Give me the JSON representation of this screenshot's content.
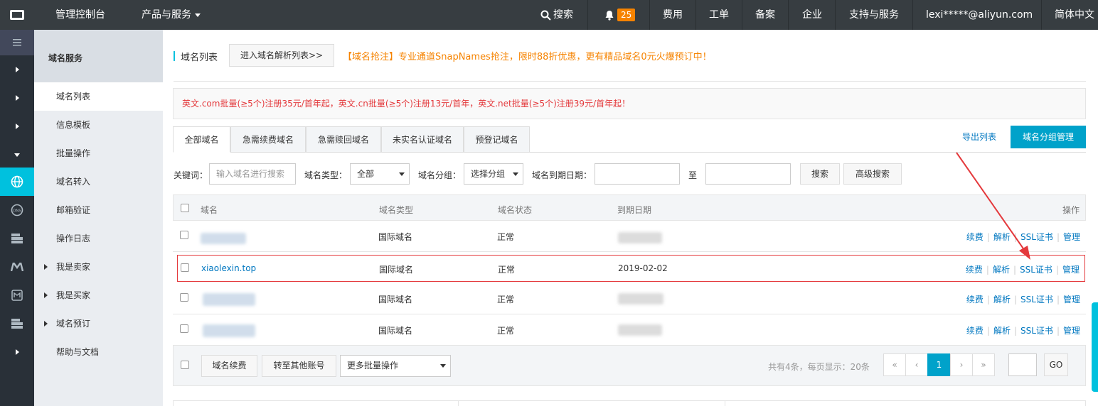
{
  "topbar": {
    "console": "管理控制台",
    "products": "产品与服务",
    "search": "搜索",
    "bell_count": "25",
    "billing": "费用",
    "ticket": "工单",
    "icp": "备案",
    "enterprise": "企业",
    "support": "支持与服务",
    "user": "lexi*****@aliyun.com",
    "language": "简体中文"
  },
  "sidebar": {
    "title": "域名服务",
    "items": [
      {
        "label": "域名列表"
      },
      {
        "label": "信息模板"
      },
      {
        "label": "批量操作"
      },
      {
        "label": "域名转入"
      },
      {
        "label": "邮箱验证"
      },
      {
        "label": "操作日志"
      },
      {
        "label": "我是卖家"
      },
      {
        "label": "我是买家"
      },
      {
        "label": "域名预订"
      },
      {
        "label": "帮助与文档"
      }
    ]
  },
  "header": {
    "title": "域名列表",
    "dns_button": "进入域名解析列表>>",
    "promo": "【域名抢注】专业通道SnapNames抢注，限时88折优惠，更有精品域名0元火爆预订中！"
  },
  "notice": "英文.com批量(≥5个)注册35元/首年起，英文.cn批量(≥5个)注册13元/首年，英文.net批量(≥5个)注册39元/首年起！",
  "tabs": [
    "全部域名",
    "急需续费域名",
    "急需赎回域名",
    "未实名认证域名",
    "预登记域名"
  ],
  "actions": {
    "export": "导出列表",
    "group_manage": "域名分组管理"
  },
  "filters": {
    "keyword_label": "关键词：",
    "keyword_placeholder": "输入域名进行搜索",
    "type_label": "域名类型：",
    "type_value": "全部",
    "group_label": "域名分组：",
    "group_value": "选择分组",
    "expiry_label": "域名到期日期：",
    "to": "至",
    "search": "搜索",
    "advanced": "高级搜索"
  },
  "table": {
    "headers": [
      "域名",
      "域名类型",
      "域名状态",
      "到期日期",
      "操作"
    ],
    "rows": [
      {
        "domain": "",
        "type": "国际域名",
        "status": "正常",
        "expiry": ""
      },
      {
        "domain": "xiaolexin.top",
        "type": "国际域名",
        "status": "正常",
        "expiry": "2019-02-02"
      },
      {
        "domain": "",
        "type": "国际域名",
        "status": "正常",
        "expiry": ""
      },
      {
        "domain": "",
        "type": "国际域名",
        "status": "正常",
        "expiry": ""
      }
    ],
    "ops": [
      "续费",
      "解析",
      "SSL证书",
      "管理"
    ]
  },
  "footer": {
    "renew": "域名续费",
    "transfer": "转至其他账号",
    "batch": "更多批量操作",
    "summary": "共有4条，每页显示：20条",
    "first": "«",
    "prev": "‹",
    "page": "1",
    "next": "›",
    "last": "»",
    "go": "GO"
  },
  "colors": {
    "topbar": "#373d41",
    "accent": "#00c1de",
    "primary": "#00a2ca",
    "link": "#0077c0",
    "notice": "#e4393c",
    "promo": "#f68300"
  }
}
